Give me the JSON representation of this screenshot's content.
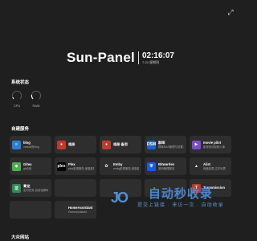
{
  "header": {
    "title": "Sun-Panel",
    "time": "02:16:07",
    "date": "7-20 星期四"
  },
  "sections": {
    "system_status": "系统状态",
    "self_hosted": "自建服务",
    "public_sites": "大众网站"
  },
  "monitor": [
    {
      "label": "CPU",
      "percent": 8,
      "icon": "cpu-gauge-icon"
    },
    {
      "label": "RAM",
      "percent": 20,
      "icon": "ram-gauge-icon"
    }
  ],
  "cards": [
    {
      "title": "blog",
      "desc": "xuhuai的blog",
      "icon": "blog-icon",
      "color": "#2a7fd6",
      "glyph": "≡"
    },
    {
      "title": "相册",
      "desc": "",
      "icon": "photo-album-icon",
      "color": "#c0392b",
      "glyph": "●"
    },
    {
      "title": "相册 备用",
      "desc": "",
      "icon": "photo-album-backup-icon",
      "color": "#c0392b",
      "glyph": "●"
    },
    {
      "title": "群晖",
      "desc": "群晖NAS管理与设置,家庭存储",
      "icon": "synology-dsm-icon",
      "color": "#1c64c8",
      "glyph": "DSM"
    },
    {
      "title": "movie pilot",
      "desc": "影视自动刮削入库",
      "icon": "movie-pilot-icon",
      "color": "#7b4bd1",
      "glyph": "▶"
    },
    {
      "title": "Gitea",
      "desc": "git仓库",
      "icon": "gitea-icon",
      "color": "#4caf50",
      "glyph": "◆"
    },
    {
      "title": "Plex",
      "desc": "plex影视服务,家庭影院",
      "icon": "plex-icon",
      "color": "#000000",
      "glyph": "plex"
    },
    {
      "title": "Emby",
      "desc": "emby影视服务,家庭影院",
      "icon": "emby-icon",
      "color": "#2e2e2e",
      "glyph": "✿"
    },
    {
      "title": "Bitwarden",
      "desc": "密码管理服务",
      "icon": "bitwarden-icon",
      "color": "#175ddc",
      "glyph": "⛨"
    },
    {
      "title": "Alist",
      "desc": "网盘挂载,文件列表",
      "icon": "alist-icon",
      "color": "#2e2e2e",
      "glyph": "▲"
    },
    {
      "title": "青龙",
      "desc": "定时任务,自动化脚本",
      "icon": "qinglong-icon",
      "color": "#2e8b57",
      "glyph": "龙"
    },
    {
      "title": "",
      "desc": "",
      "icon": "",
      "color": "#2e2e2e",
      "glyph": ""
    },
    {
      "title": "",
      "desc": "",
      "icon": "",
      "color": "#2e2e2e",
      "glyph": ""
    },
    {
      "title": "",
      "desc": "",
      "icon": "",
      "color": "#2e2e2e",
      "glyph": ""
    },
    {
      "title": "Transmission",
      "desc": "",
      "icon": "transmission-icon",
      "color": "#c0392b",
      "glyph": "T"
    },
    {
      "title": "",
      "desc": "",
      "icon": "",
      "color": "#2e2e2e",
      "glyph": ""
    },
    {
      "title": "HomeAssistant",
      "desc": "HomeAssistant",
      "icon": "homeassistant-icon",
      "color": "#2e2e2e",
      "glyph": ""
    }
  ],
  "watermark": {
    "logo": "JO",
    "main": "自动秒收录",
    "sub": "提交上链接 · 来访一次 · 自动收录"
  },
  "colors": {
    "background": "#1f1f1f",
    "card": "#2e2e2e",
    "accent": "#4f95ee"
  }
}
